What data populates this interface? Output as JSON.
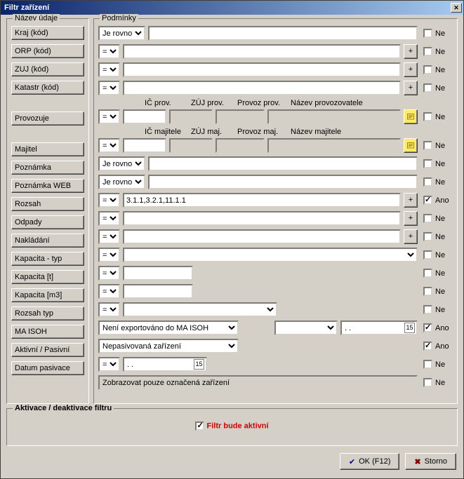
{
  "window": {
    "title": "Filtr zařízení"
  },
  "groups": {
    "labels": "Název údaje",
    "cond": "Podmínky",
    "activation": "Aktivace / deaktivace filtru"
  },
  "operators": {
    "je_rovno": "Je rovno",
    "eq": "="
  },
  "labels": {
    "kraj": "Kraj (kód)",
    "orp": "ORP (kód)",
    "zuj": "ZUJ (kód)",
    "katastr": "Katastr (kód)",
    "provozuje": "Provozuje",
    "majitel": "Majitel",
    "poznamka": "Poznámka",
    "poznamka_web": "Poznámka WEB",
    "rozsah": "Rozsah",
    "odpady": "Odpady",
    "nakladani": "Nakládání",
    "kapacita_typ": "Kapacita - typ",
    "kapacita_t": "Kapacita [t]",
    "kapacita_m3": "Kapacita [m3]",
    "rozsah_typ": "Rozsah typ",
    "ma_isoh": "MA ISOH",
    "aktivni": "Aktivní / Pasivní",
    "datum_pasivace": "Datum pasivace"
  },
  "headers": {
    "ic_prov": "IČ prov.",
    "zuj_prov": "ZÚJ prov.",
    "provoz_prov": "Provoz prov.",
    "nazev_prov": "Název provozovatele",
    "ic_maj": "IČ majitele",
    "zuj_maj": "ZÚJ maj.",
    "provoz_maj": "Provoz maj.",
    "nazev_maj": "Název majitele"
  },
  "values": {
    "rozsah": "3.1.1,3.2.1,11.1.1",
    "ma_isoh": "Není exportováno do MA ISOH",
    "aktivni": "Nepasivovaná zařízení",
    "date_empty": ".   .",
    "show_marked": "Zobrazovat pouze označená zařízení"
  },
  "ne": "Ne",
  "ano": "Ano",
  "activation_label": "Filtr bude aktivní",
  "buttons": {
    "ok": "OK (F12)",
    "storno": "Storno",
    "plus": "+"
  }
}
